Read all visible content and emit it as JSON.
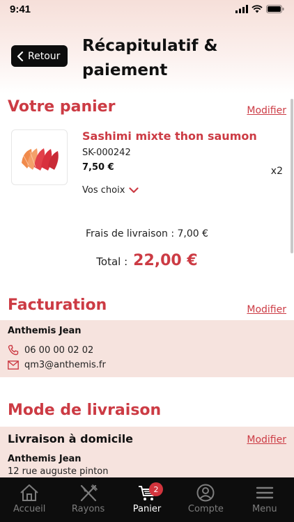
{
  "status": {
    "time": "9:41"
  },
  "header": {
    "back_label": "Retour",
    "title_line1": "Récapitulatif &",
    "title_line2": "paiement"
  },
  "cart": {
    "title": "Votre panier",
    "modify_label": "Modifier",
    "item": {
      "name": "Sashimi mixte thon saumon",
      "ref": "SK-000242",
      "price": "7,50 €",
      "quantity": "x2",
      "choices_label": "Vos choix"
    },
    "delivery_fee": "Frais de livraison : 7,00 €",
    "total_label": "Total :",
    "total_value": "22,00 €"
  },
  "billing": {
    "title": "Facturation",
    "modify_label": "Modifier",
    "name": "Anthemis Jean",
    "phone": "06 00 00 02 02",
    "email": "qm3@anthemis.fr"
  },
  "delivery": {
    "title": "Mode de livraison",
    "type": "Livraison à domicile",
    "modify_label": "Modifier",
    "name": "Anthemis Jean",
    "street": "12 rue auguste pinton"
  },
  "tabs": [
    {
      "label": "Accueil",
      "icon": "home-icon"
    },
    {
      "label": "Rayons",
      "icon": "fork-knife-icon"
    },
    {
      "label": "Panier",
      "icon": "cart-icon",
      "badge": "2",
      "active": true
    },
    {
      "label": "Compte",
      "icon": "account-icon"
    },
    {
      "label": "Menu",
      "icon": "menu-icon"
    }
  ],
  "colors": {
    "accent": "#cc3b44",
    "panel_bg": "#f6e3de",
    "tab_bar_bg": "#0d0d0d"
  }
}
